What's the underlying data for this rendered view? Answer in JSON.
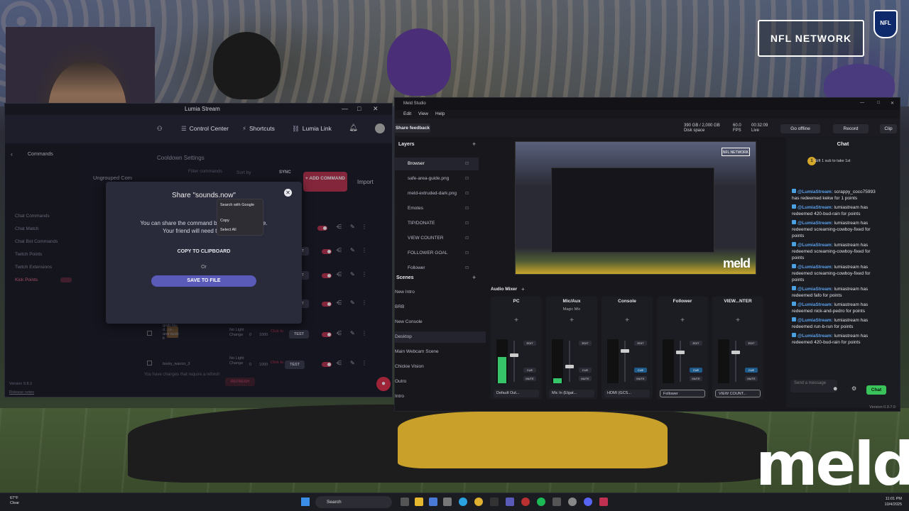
{
  "background": {
    "network_badge": "NFL NETWORK",
    "shield_text": "NFL",
    "watermark": "meld"
  },
  "lumia": {
    "window_title": "Lumia Stream",
    "nav": [
      "Control Center",
      "Shortcuts",
      "Lumia Link"
    ],
    "sidebar_header": "Commands",
    "sidebar_items": [
      "Chat Commands",
      "Chat Match",
      "Chat Bot Commands",
      "Twitch Points",
      "Twitch Extensions",
      "Kick Points"
    ],
    "version": "Version 9.8.3",
    "release_notes": "Release notes",
    "cooldown_settings": "Cooldown Settings",
    "filter_placeholder": "Filter commands",
    "sort_by": "Sort by",
    "sync": "SYNC",
    "add_command": "ADD COMMAND",
    "import": "Import",
    "ungrouped": "Ungrouped Com",
    "rows": [
      {
        "name": "grab-his-d...ck-and-twist-it",
        "light": "No Light Change",
        "n1": "0",
        "n2": "1000",
        "clickto": "Click to"
      },
      {
        "name": "booty_warcio_3",
        "light": "No Light Change",
        "n1": "0",
        "n2": "1000",
        "clickto": "Click to"
      }
    ],
    "test_label": "TEST",
    "changes_notice": "You have changes that require a refresh",
    "refresh": "REFRESH",
    "modal": {
      "title": "Share \"sounds.now\"",
      "body_line1": "You can share the command by sending... to a file.",
      "body_line2": "Your friend will need to import i...",
      "copy_btn": "COPY TO CLIPBOARD",
      "or": "Or",
      "save_btn": "SAVE TO FILE"
    },
    "context_menu": [
      "Search with Google",
      "Copy",
      "Select All"
    ]
  },
  "meld": {
    "window_title": "Meld Studio",
    "menu": [
      "Edit",
      "View",
      "Help"
    ],
    "share_feedback": "Share feedback",
    "disk": "390 GB / 2,000 GB",
    "disk_label": "Disk space",
    "fps": "60.0",
    "fps_label": "FPS",
    "live_time": "00:32:09",
    "live_label": "Live",
    "go_offline": "Go offline",
    "record": "Record",
    "clip": "Clip",
    "layers_title": "Layers",
    "layers": [
      "Browser",
      "safe-area-guide.png",
      "meld-extruded-dark.png",
      "Emotes",
      "TIP/DONATE",
      "VIEW COUNTER",
      "FOLLOWER GOAL",
      "Follower"
    ],
    "scenes_title": "Scenes",
    "scenes": [
      "New Intro",
      "BRB",
      "New Console",
      "Desktop",
      "Main Webcam Scene",
      "Chickie Vision",
      "Outro",
      "Intro"
    ],
    "mixer_title": "Audio Mixer",
    "strips": [
      {
        "name": "PC",
        "sub": "",
        "device": "Default Out..."
      },
      {
        "name": "Mic/Aux",
        "sub": "Magic Mic",
        "device": "Mic In (Elgat..."
      },
      {
        "name": "Console",
        "sub": "",
        "device": "HDMI (GCS..."
      },
      {
        "name": "Follower",
        "sub": "",
        "device": "Follower"
      },
      {
        "name": "VIEW...NTER",
        "sub": "",
        "device": "VIEW COUNT..."
      }
    ],
    "strip_buttons": [
      "EDIT",
      "CUE",
      "MUTE"
    ],
    "preview_badge": "NFL NETWORK",
    "preview_watermark": "meld",
    "chat": {
      "title": "Chat",
      "gift": "Gift 1 sub to take 1st",
      "messages": [
        {
          "user": "@LumiaStream:",
          "text": "scrappy_coco75993 has redeemed kekw for 1 points"
        },
        {
          "user": "@LumiaStream:",
          "text": "lumiastream has redeemed 420-bud-rain for points"
        },
        {
          "user": "@LumiaStream:",
          "text": "lumiastream has redeemed screaming-cowboy-fixed for points"
        },
        {
          "user": "@LumiaStream:",
          "text": "lumiastream has redeemed screaming-cowboy-fixed for points"
        },
        {
          "user": "@LumiaStream:",
          "text": "lumiastream has redeemed screaming-cowboy-fixed for points"
        },
        {
          "user": "@LumiaStream:",
          "text": "lumiastream has redeemed fafo for points"
        },
        {
          "user": "@LumiaStream:",
          "text": "lumiastream has redeemed nick-and-pedro for points"
        },
        {
          "user": "@LumiaStream:",
          "text": "lumiastream has redeemed run-b-run for points"
        },
        {
          "user": "@LumiaStream:",
          "text": "lumiastream has redeemed 420-bud-rain for points"
        }
      ],
      "input_placeholder": "Send a message",
      "send": "Chat"
    },
    "version": "Version 0.9.7.0"
  },
  "taskbar": {
    "temp": "67°F",
    "weather": "Clear",
    "search": "Search",
    "time": "11:01 PM",
    "date": "10/4/2025"
  },
  "colors": {
    "lumia_accent": "#b8334f",
    "meld_go_live": "#39c35a",
    "chat_user": "#5aa0e8"
  }
}
